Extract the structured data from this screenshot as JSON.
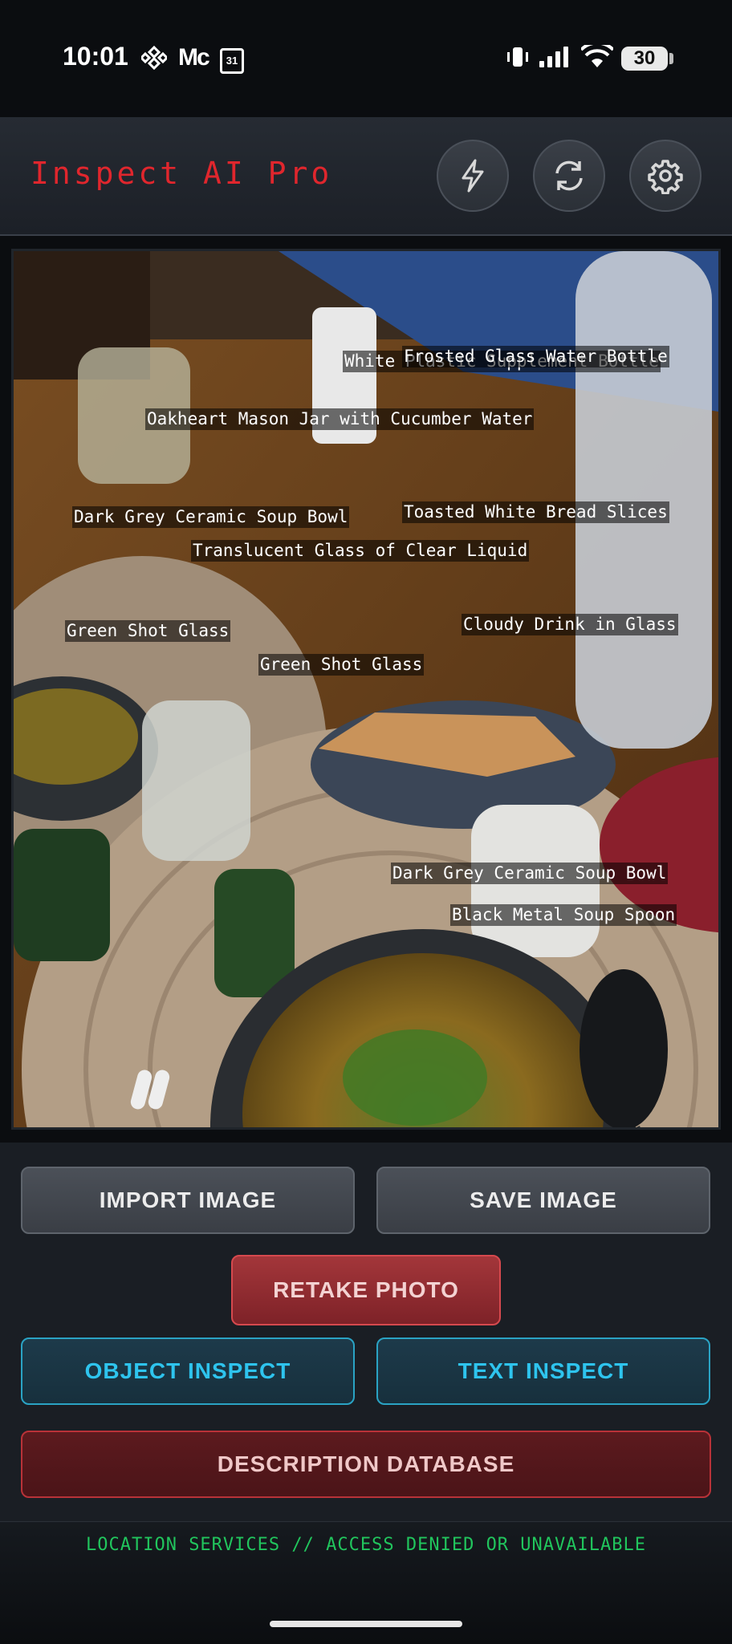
{
  "status_bar": {
    "time": "10:01",
    "carrier_text": "Mc",
    "calendar_day": "31",
    "battery": "30"
  },
  "header": {
    "title": "Inspect AI Pro",
    "actions": [
      {
        "icon": "lightning-icon"
      },
      {
        "icon": "refresh-icon"
      },
      {
        "icon": "gear-icon"
      }
    ]
  },
  "detections": [
    "Frosted Glass Water Bottle",
    "White Plastic Supplement Bottle",
    "Oakheart Mason Jar with Cucumber Water",
    "Dark Grey Ceramic Soup Bowl",
    "Toasted White Bread Slices",
    "Translucent Glass of Clear Liquid",
    "Green Shot Glass",
    "Cloudy Drink in Glass",
    "Green Shot Glass",
    "Dark Grey Ceramic Soup Bowl",
    "Black Metal Soup Spoon"
  ],
  "buttons": {
    "import": "IMPORT IMAGE",
    "save": "SAVE IMAGE",
    "retake": "RETAKE PHOTO",
    "object_inspect": "OBJECT INSPECT",
    "text_inspect": "TEXT INSPECT",
    "database": "DESCRIPTION DATABASE"
  },
  "footer": {
    "status": "LOCATION SERVICES // ACCESS DENIED OR UNAVAILABLE"
  }
}
